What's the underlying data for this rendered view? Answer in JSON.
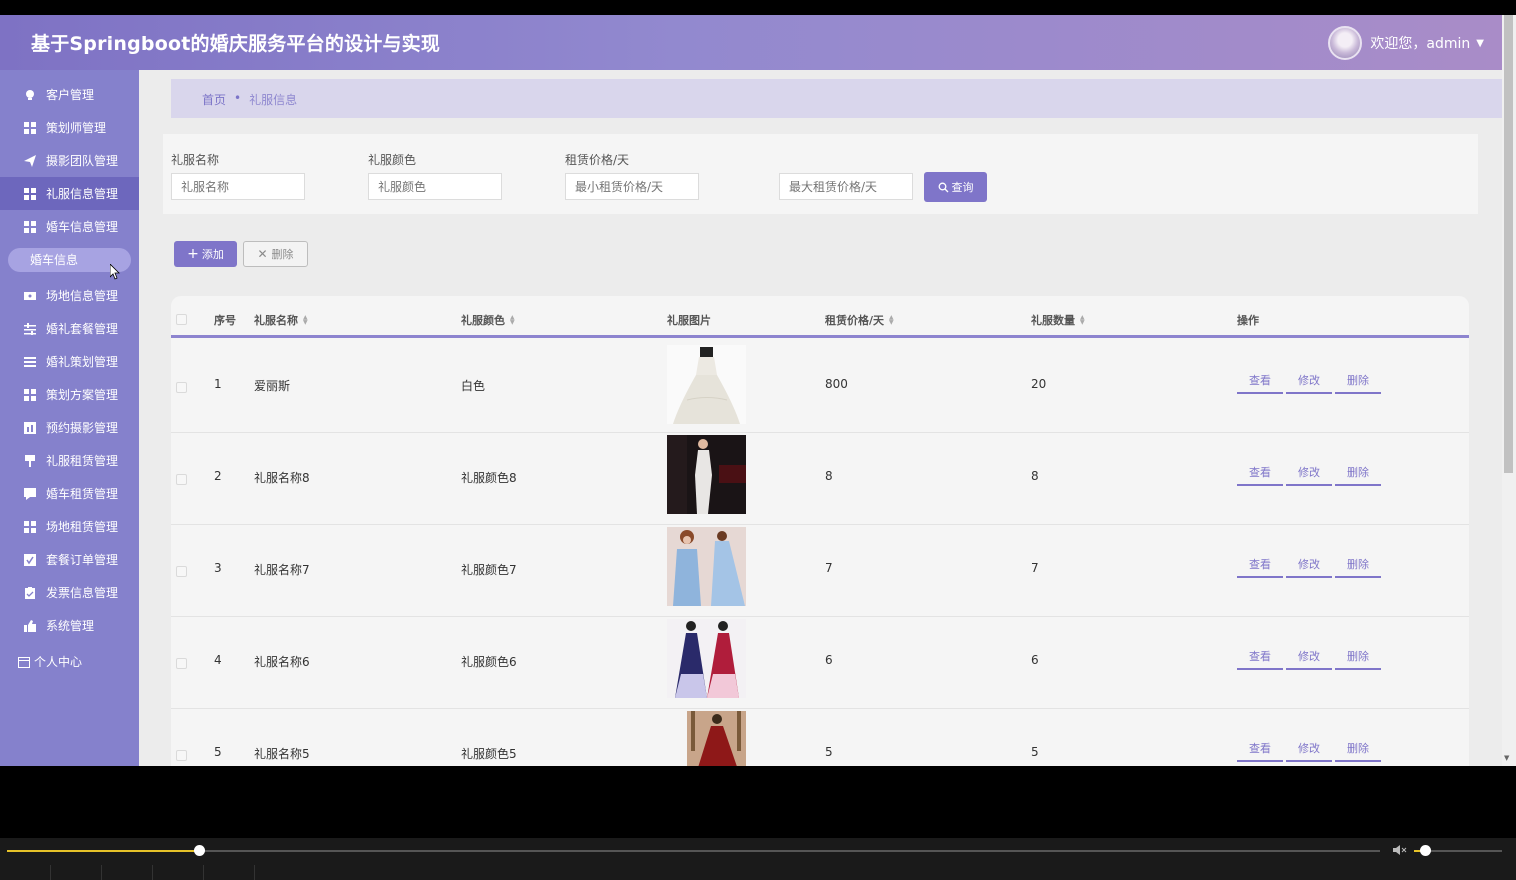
{
  "app": {
    "title": "基于Springboot的婚庆服务平台的设计与实现"
  },
  "user": {
    "greeting": "欢迎您，admin"
  },
  "sidebar": {
    "items": [
      {
        "label": "客户管理",
        "icon": "bulb-icon"
      },
      {
        "label": "策划师管理",
        "icon": "grid-icon"
      },
      {
        "label": "摄影团队管理",
        "icon": "send-icon"
      },
      {
        "label": "礼服信息管理",
        "icon": "grid-icon"
      },
      {
        "label": "婚车信息管理",
        "icon": "grid-icon"
      },
      {
        "label": "场地信息管理",
        "icon": "ticket-icon"
      },
      {
        "label": "婚礼套餐管理",
        "icon": "sliders-icon"
      },
      {
        "label": "婚礼策划管理",
        "icon": "list-icon"
      },
      {
        "label": "策划方案管理",
        "icon": "grid-icon"
      },
      {
        "label": "预约摄影管理",
        "icon": "chart-icon"
      },
      {
        "label": "礼服租赁管理",
        "icon": "brush-icon"
      },
      {
        "label": "婚车租赁管理",
        "icon": "chat-icon"
      },
      {
        "label": "场地租赁管理",
        "icon": "grid-icon"
      },
      {
        "label": "套餐订单管理",
        "icon": "check-icon"
      },
      {
        "label": "发票信息管理",
        "icon": "clipboard-icon"
      },
      {
        "label": "系统管理",
        "icon": "thumb-icon"
      }
    ],
    "sub_item": "婚车信息",
    "personal": "个人中心"
  },
  "breadcrumb": {
    "home": "首页",
    "separator": "•",
    "current": "礼服信息"
  },
  "search": {
    "name_label": "礼服名称",
    "name_placeholder": "礼服名称",
    "color_label": "礼服颜色",
    "color_placeholder": "礼服颜色",
    "price_label": "租赁价格/天",
    "price_min_placeholder": "最小租赁价格/天",
    "price_max_placeholder": "最大租赁价格/天",
    "query_label": "查询"
  },
  "actions": {
    "add_label": "添加",
    "delete_label": "删除"
  },
  "table": {
    "headers": {
      "index": "序号",
      "name": "礼服名称",
      "color": "礼服颜色",
      "image": "礼服图片",
      "price": "租赁价格/天",
      "quantity": "礼服数量",
      "ops": "操作"
    },
    "rows": [
      {
        "index": "1",
        "name": "爱丽斯",
        "color": "白色",
        "price": "800",
        "quantity": "20"
      },
      {
        "index": "2",
        "name": "礼服名称8",
        "color": "礼服颜色8",
        "price": "8",
        "quantity": "8"
      },
      {
        "index": "3",
        "name": "礼服名称7",
        "color": "礼服颜色7",
        "price": "7",
        "quantity": "7"
      },
      {
        "index": "4",
        "name": "礼服名称6",
        "color": "礼服颜色6",
        "price": "6",
        "quantity": "6"
      },
      {
        "index": "5",
        "name": "礼服名称5",
        "color": "礼服颜色5",
        "price": "5",
        "quantity": "5"
      }
    ],
    "op_view": "查看",
    "op_edit": "修改",
    "op_delete": "删除"
  },
  "player": {
    "progress": 0.14,
    "volume": 0.1
  },
  "colors": {
    "accent": "#7f75c9",
    "sidebar": "#8581cc",
    "progress": "#e6c229"
  }
}
